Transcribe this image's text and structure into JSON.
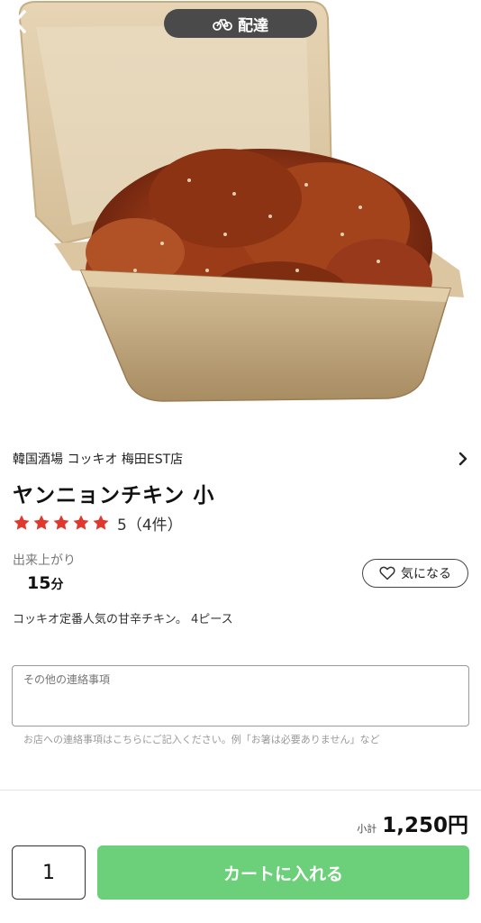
{
  "header": {
    "back_icon": "chevron-left-icon",
    "mode_icon": "bicycle-icon",
    "mode_label": "配達"
  },
  "item": {
    "store_name": "韓国酒場 コッキオ 梅田EST店",
    "title": "ヤンニョンチキン 小",
    "rating": 5,
    "rating_text": "5（4件）",
    "prep_label": "出来上がり",
    "prep_value": "15",
    "prep_unit": "分",
    "favorite_label": "気になる",
    "description": "コッキオ定番人気の甘辛チキン。 4ピース"
  },
  "note": {
    "placeholder": "その他の連絡事項",
    "help": "お店への連絡事項はこちらにご記入ください。例「お箸は必要ありません」など"
  },
  "footer": {
    "subtotal_label": "小計",
    "subtotal_value": "1,250円",
    "quantity": "1",
    "cart_label": "カートに入れる"
  },
  "colors": {
    "accent_green": "#6ccf79",
    "star_red": "#e0382c",
    "pill_bg": "#4a4a4a"
  }
}
